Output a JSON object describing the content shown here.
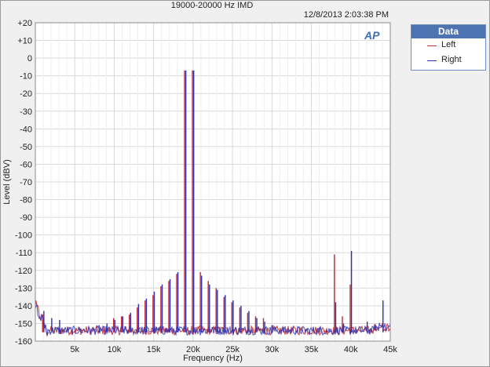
{
  "chart_data": {
    "type": "line",
    "title": "19000-20000 Hz IMD",
    "timestamp": "12/8/2013 2:03:38 PM",
    "xlabel": "Frequency (Hz)",
    "ylabel": "Level (dBV)",
    "xlim": [
      0,
      45000
    ],
    "ylim": [
      -160,
      20
    ],
    "xticks": [
      5000,
      10000,
      15000,
      20000,
      25000,
      30000,
      35000,
      40000,
      45000
    ],
    "xtick_labels": [
      "5k",
      "10k",
      "15k",
      "20k",
      "25k",
      "30k",
      "35k",
      "40k",
      "45k"
    ],
    "yticks": [
      20,
      10,
      0,
      -10,
      -20,
      -30,
      -40,
      -50,
      -60,
      -70,
      -80,
      -90,
      -100,
      -110,
      -120,
      -130,
      -140,
      -150,
      -160
    ],
    "ytick_labels": [
      "+20",
      "+10",
      "0",
      "-10",
      "-20",
      "-30",
      "-40",
      "-50",
      "-60",
      "-70",
      "-80",
      "-90",
      "-100",
      "-110",
      "-120",
      "-130",
      "-140",
      "-150",
      "-160"
    ],
    "grid": true,
    "legend": {
      "title": "Data",
      "position": "right-top"
    },
    "noise_floor": -155,
    "series": [
      {
        "name": "Left",
        "color": "#c0282d",
        "peaks": [
          [
            19000,
            -7
          ],
          [
            20000,
            -7
          ],
          [
            18000,
            -122
          ],
          [
            21000,
            -121
          ],
          [
            17000,
            -126
          ],
          [
            22000,
            -126
          ],
          [
            16000,
            -129
          ],
          [
            23000,
            -130
          ],
          [
            15000,
            -134
          ],
          [
            24000,
            -135
          ],
          [
            14000,
            -137
          ],
          [
            25000,
            -138
          ],
          [
            13000,
            -141
          ],
          [
            26000,
            -141
          ],
          [
            12000,
            -145
          ],
          [
            27000,
            -144
          ],
          [
            11000,
            -146
          ],
          [
            28000,
            -146
          ],
          [
            10000,
            -147
          ],
          [
            29000,
            -147
          ],
          [
            1000,
            -145
          ],
          [
            38000,
            -111
          ],
          [
            40000,
            -128
          ],
          [
            39000,
            -146
          ]
        ]
      },
      {
        "name": "Right",
        "color": "#2b33b5",
        "peaks": [
          [
            19000,
            -7
          ],
          [
            20000,
            -7
          ],
          [
            18000,
            -121
          ],
          [
            21000,
            -123
          ],
          [
            17000,
            -125
          ],
          [
            22000,
            -128
          ],
          [
            16000,
            -128
          ],
          [
            23000,
            -131
          ],
          [
            15000,
            -132
          ],
          [
            24000,
            -134
          ],
          [
            14000,
            -136
          ],
          [
            25000,
            -137
          ],
          [
            13000,
            -139
          ],
          [
            26000,
            -140
          ],
          [
            12000,
            -144
          ],
          [
            27000,
            -143
          ],
          [
            11000,
            -146
          ],
          [
            28000,
            -147
          ],
          [
            10000,
            -148
          ],
          [
            29000,
            -149
          ],
          [
            30000,
            -151
          ],
          [
            9000,
            -150
          ],
          [
            8000,
            -151
          ],
          [
            3000,
            -148
          ],
          [
            2000,
            -147
          ],
          [
            1000,
            -143
          ],
          [
            38000,
            -138
          ],
          [
            40000,
            -109
          ],
          [
            36000,
            -152
          ],
          [
            39000,
            -150
          ],
          [
            42000,
            -149
          ],
          [
            44000,
            -137
          ]
        ]
      }
    ]
  }
}
